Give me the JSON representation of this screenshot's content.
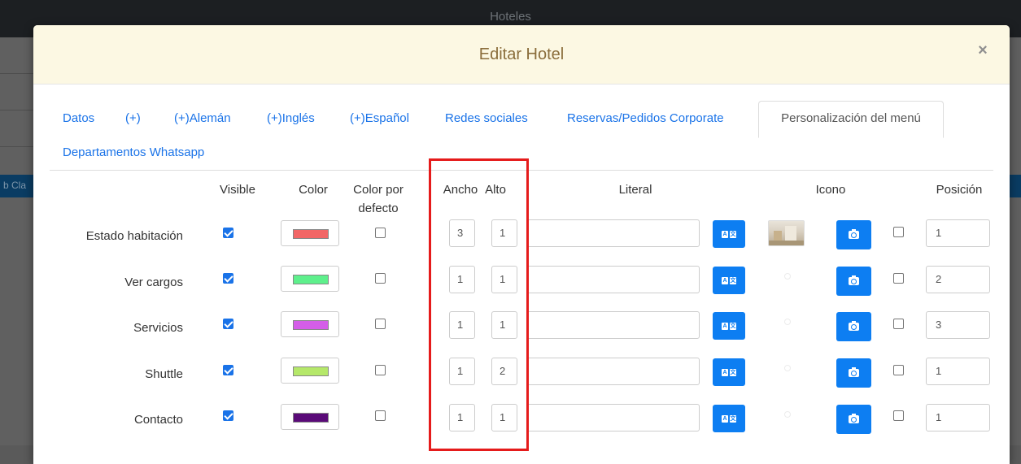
{
  "app": {
    "title": "Hoteles",
    "side_fragment": "b Cla"
  },
  "modal": {
    "title": "Editar Hotel",
    "close_label": "×"
  },
  "tabs": [
    {
      "label": "Datos",
      "active": false
    },
    {
      "label": "(+)",
      "active": false
    },
    {
      "label": "(+)Alemán",
      "active": false
    },
    {
      "label": "(+)Inglés",
      "active": false
    },
    {
      "label": "(+)Español",
      "active": false
    },
    {
      "label": "Redes sociales",
      "active": false
    },
    {
      "label": "Reservas/Pedidos Corporate",
      "active": false
    },
    {
      "label": "Personalización del menú",
      "active": true
    },
    {
      "label": "Departamentos Whatsapp",
      "active": false
    }
  ],
  "columns": {
    "visible": "Visible",
    "color": "Color",
    "default_color_1": "Color por",
    "default_color_2": "defecto",
    "width": "Ancho",
    "height": "Alto",
    "literal": "Literal",
    "icon": "Icono",
    "position": "Posición"
  },
  "rows": [
    {
      "label": "Estado habitación",
      "visible": true,
      "color": "#f26666",
      "default_color": false,
      "width": "3",
      "height": "1",
      "literal": "",
      "has_icon": true,
      "icon_checked": false,
      "position": "1"
    },
    {
      "label": "Ver cargos",
      "visible": true,
      "color": "#5ef08c",
      "default_color": false,
      "width": "1",
      "height": "1",
      "literal": "",
      "has_icon": false,
      "icon_checked": false,
      "position": "2"
    },
    {
      "label": "Servicios",
      "visible": true,
      "color": "#d45ee8",
      "default_color": false,
      "width": "1",
      "height": "1",
      "literal": "",
      "has_icon": false,
      "icon_checked": false,
      "position": "3"
    },
    {
      "label": "Shuttle",
      "visible": true,
      "color": "#b5e86a",
      "default_color": false,
      "width": "1",
      "height": "2",
      "literal": "",
      "has_icon": false,
      "icon_checked": false,
      "position": "1"
    },
    {
      "label": "Contacto",
      "visible": true,
      "color": "#5a0a78",
      "default_color": false,
      "width": "1",
      "height": "1",
      "literal": "",
      "has_icon": false,
      "icon_checked": false,
      "position": "1"
    }
  ],
  "icons": {
    "translate": "translate-icon",
    "camera": "camera-icon",
    "close": "close-icon"
  },
  "colors": {
    "header_bg": "#fcf8e3",
    "title": "#8a6d3b",
    "link": "#1a73e8",
    "button": "#0d7ef2",
    "highlight": "#e51b1b"
  }
}
